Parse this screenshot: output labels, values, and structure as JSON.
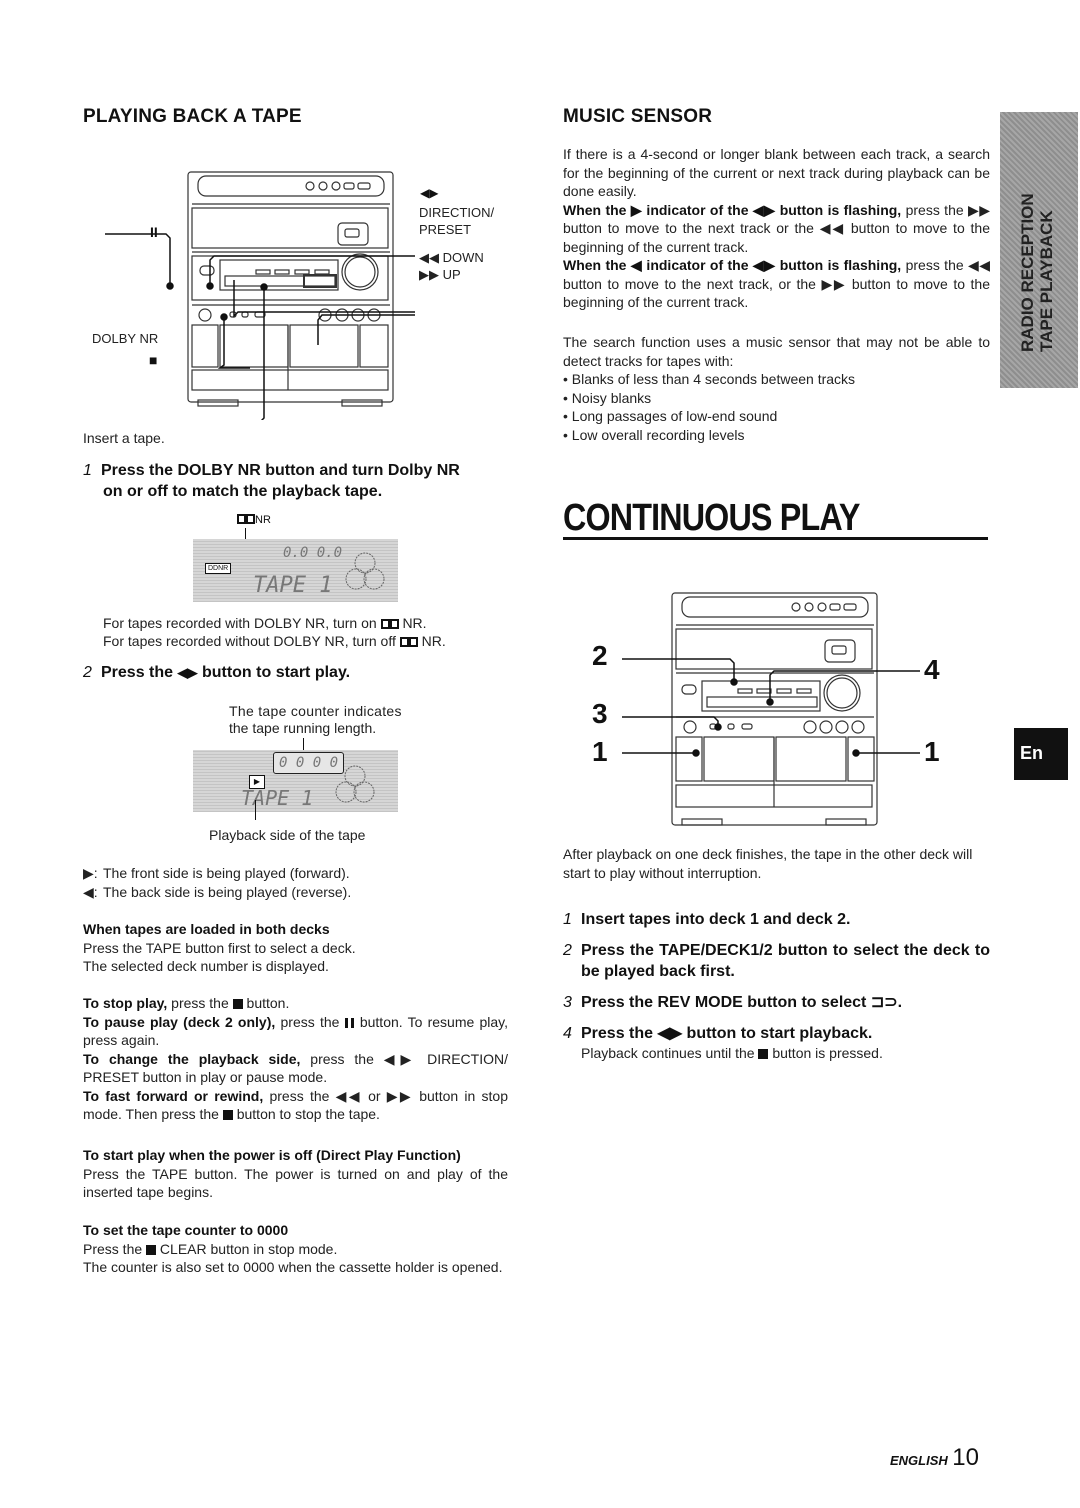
{
  "left": {
    "heading": "PLAYING BACK A TAPE",
    "figure1": {
      "callouts": {
        "pause": "II",
        "direction_symbol": "◀▶",
        "direction_label_1": "DIRECTION/",
        "direction_label_2": "PRESET",
        "down": "◀◀ DOWN",
        "up": "▶▶ UP",
        "dolby": "DOLBY NR",
        "stop": "■"
      },
      "caption": "Insert a tape."
    },
    "step1": {
      "num": "1",
      "text_line1": "Press the DOLBY NR button and turn Dolby NR",
      "text_line2": "on or off to match the playback tape.",
      "display_label": "NR",
      "display_counter": "0.0 0.0",
      "display_mode": "TAPE 1",
      "display_badge": "DDNR",
      "note1": "For tapes recorded with DOLBY NR, turn on",
      "note1_end": "NR.",
      "note2": "For tapes recorded without DOLBY NR, turn off",
      "note2_end": "NR."
    },
    "step2": {
      "num": "2",
      "text_pre": "Press the",
      "symbol": "◀▶",
      "text_post": "button to start play.",
      "counter_note_1": "The tape counter indicates",
      "counter_note_2": "the tape running length.",
      "display_counter": "0 0 0 0",
      "display_mode": "TAPE 1",
      "side_caption": "Playback side of the tape",
      "forward_symbol": "▶:",
      "forward_text": "The front side is being played (forward).",
      "reverse_symbol": "◀:",
      "reverse_text": "The back side is being played (reverse)."
    },
    "both_decks": {
      "heading": "When tapes are loaded in both decks",
      "line1": "Press the TAPE button first to select a deck.",
      "line2": "The selected deck number is displayed."
    },
    "ops": {
      "stop_b": "To stop play,",
      "stop_t1": "press the",
      "stop_t2": "button.",
      "pause_b": "To pause play (deck 2 only),",
      "pause_t1": "press the",
      "pause_t2": "button.  To resume play, press again.",
      "side_b": "To change the playback side,",
      "side_t": "press the ◀▶ DIRECTION/ PRESET button in play or pause mode.",
      "ff_b": "To fast forward or rewind,",
      "ff_t1": "press the ◀◀ or ▶▶ button in stop mode.  Then press the",
      "ff_t2": "button to stop the tape."
    },
    "direct_play": {
      "heading": "To start play when the power is off (Direct Play Function)",
      "text": "Press the TAPE button.  The power is turned on and play of the inserted tape begins."
    },
    "counter_reset": {
      "heading": "To set the tape counter to 0000",
      "line1_pre": "Press the",
      "line1_post": "CLEAR button in stop mode.",
      "line2": "The counter is also set to 0000 when the cassette holder is opened."
    }
  },
  "right": {
    "heading": "MUSIC SENSOR",
    "intro": "If there is a 4-second or longer blank between each track, a search for the beginning of the current or next track during playback can be done easily.",
    "para1_b": "When the ▶ indicator of the ◀▶ button is flashing,",
    "para1_t": "press the ▶▶ button to move to the next track or the ◀◀ button to move to the beginning of the current track.",
    "para2_b": "When the ◀ indicator of the ◀▶ button is flashing,",
    "para2_t": "press the ◀◀ button to move to the next track, or the ▶▶ button to move to the beginning of the current track.",
    "limits_intro": "The search function uses a music sensor that may not be able to detect tracks for tapes with:",
    "limits": [
      "• Blanks of less than 4 seconds between tracks",
      "• Noisy blanks",
      "• Long passages of low-end sound",
      "• Low overall recording levels"
    ],
    "continuous": {
      "title": "CONTINUOUS PLAY",
      "callouts": [
        "2",
        "3",
        "1",
        "4",
        "1"
      ],
      "after_text": "After playback on one deck finishes, the tape in the other deck will start to play without interruption.",
      "steps": [
        {
          "num": "1",
          "text": "Insert tapes into deck 1 and deck 2."
        },
        {
          "num": "2",
          "text": "Press the TAPE/DECK1/2 button to select the deck to be played back first."
        },
        {
          "num": "3",
          "text": "Press the REV MODE button to select ⊐⊃."
        },
        {
          "num": "4",
          "text": "Press the ◀▶ button to start playback."
        }
      ],
      "step4_note_pre": "Playback continues until the",
      "step4_note_post": "button is pressed."
    }
  },
  "sidetab": {
    "line1": "RADIO RECEPTION",
    "line2": "TAPE PLAYBACK"
  },
  "lang_tab": "En",
  "footer": {
    "language": "ENGLISH",
    "page": "10"
  }
}
